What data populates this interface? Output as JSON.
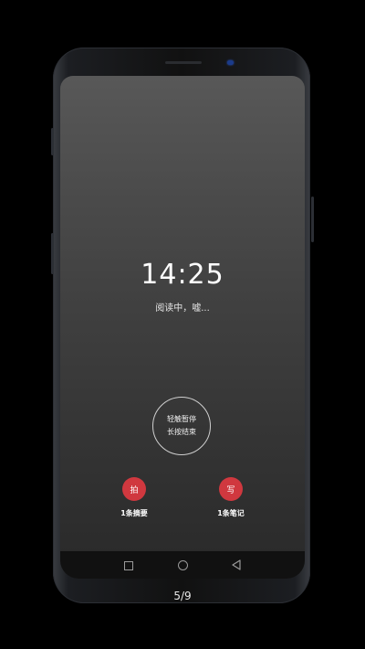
{
  "clock": {
    "time": "14:25"
  },
  "status": {
    "text": "阅读中，嘘..."
  },
  "pause_control": {
    "line1": "轻触暂停",
    "line2": "长按结束"
  },
  "actions": [
    {
      "button": "拍",
      "label": "1条摘要"
    },
    {
      "button": "写",
      "label": "1条笔记"
    }
  ],
  "pager": {
    "text": "5/9"
  },
  "colors": {
    "accent": "#d0383f",
    "background": "#000000"
  },
  "icons": {
    "nav": [
      "recent-apps-square-icon",
      "home-circle-icon",
      "back-triangle-icon"
    ]
  }
}
